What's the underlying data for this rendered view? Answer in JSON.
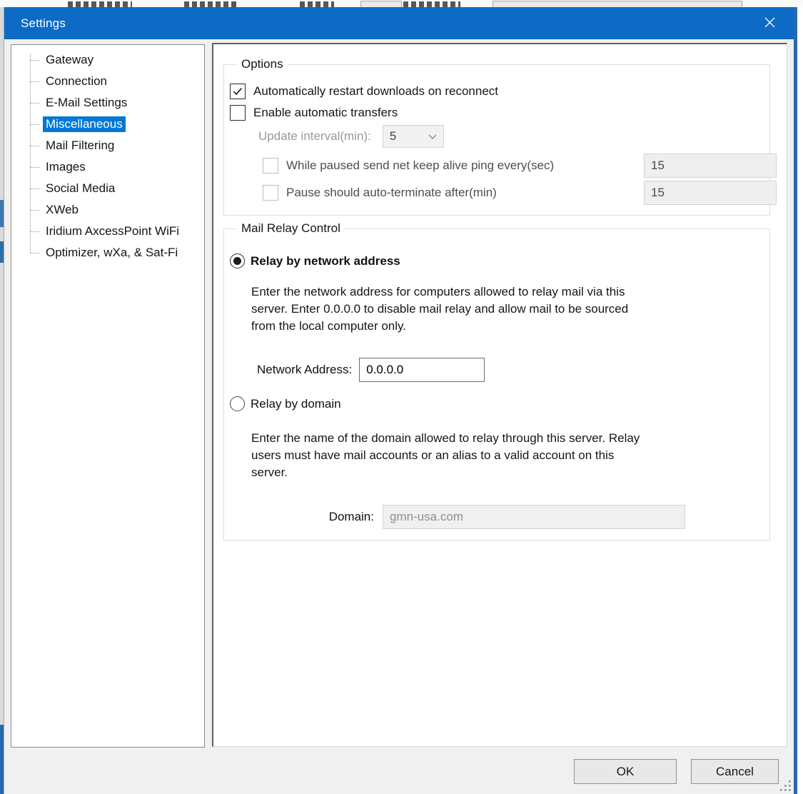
{
  "window": {
    "title": "Settings"
  },
  "colors": {
    "titlebar": "#0d6bc5",
    "selection": "#0078d7",
    "dialog_bg": "#f0f0f0",
    "accent_border": "#2968ac"
  },
  "sidebar": {
    "items": [
      {
        "label": "Gateway",
        "selected": false
      },
      {
        "label": "Connection",
        "selected": false
      },
      {
        "label": "E-Mail Settings",
        "selected": false
      },
      {
        "label": "Miscellaneous",
        "selected": true
      },
      {
        "label": "Mail Filtering",
        "selected": false
      },
      {
        "label": "Images",
        "selected": false
      },
      {
        "label": "Social Media",
        "selected": false
      },
      {
        "label": "XWeb",
        "selected": false
      },
      {
        "label": "Iridium AxcessPoint WiFi",
        "selected": false
      },
      {
        "label": "Optimizer, wXa, & Sat-Fi",
        "selected": false
      }
    ]
  },
  "options_group": {
    "title": "Options",
    "restart_downloads": {
      "label": "Automatically restart downloads on reconnect",
      "checked": true
    },
    "auto_transfers": {
      "label": "Enable automatic transfers",
      "checked": false
    },
    "update_interval": {
      "label": "Update interval(min):",
      "value": "5"
    },
    "keep_alive": {
      "label": "While paused send net keep alive ping every(sec)",
      "checked": false,
      "value": "15"
    },
    "auto_terminate": {
      "label": "Pause should auto-terminate after(min)",
      "checked": false,
      "value": "15"
    }
  },
  "mail_relay_group": {
    "title": "Mail Relay Control",
    "relay_by_network": {
      "label": "Relay by network address",
      "selected": true
    },
    "network_help": "Enter the network address for computers allowed to relay mail via this server. Enter 0.0.0.0 to disable mail relay and allow mail to be sourced from the local computer only.",
    "network_address": {
      "label": "Network Address:",
      "value": "0.0.0.0"
    },
    "relay_by_domain": {
      "label": "Relay by domain",
      "selected": false
    },
    "domain_help": "Enter the name of the domain allowed to relay through this server. Relay users must have mail accounts or an alias to a valid account on this server.",
    "domain": {
      "label": "Domain:",
      "value": "gmn-usa.com"
    }
  },
  "footer": {
    "ok_label": "OK",
    "cancel_label": "Cancel"
  }
}
